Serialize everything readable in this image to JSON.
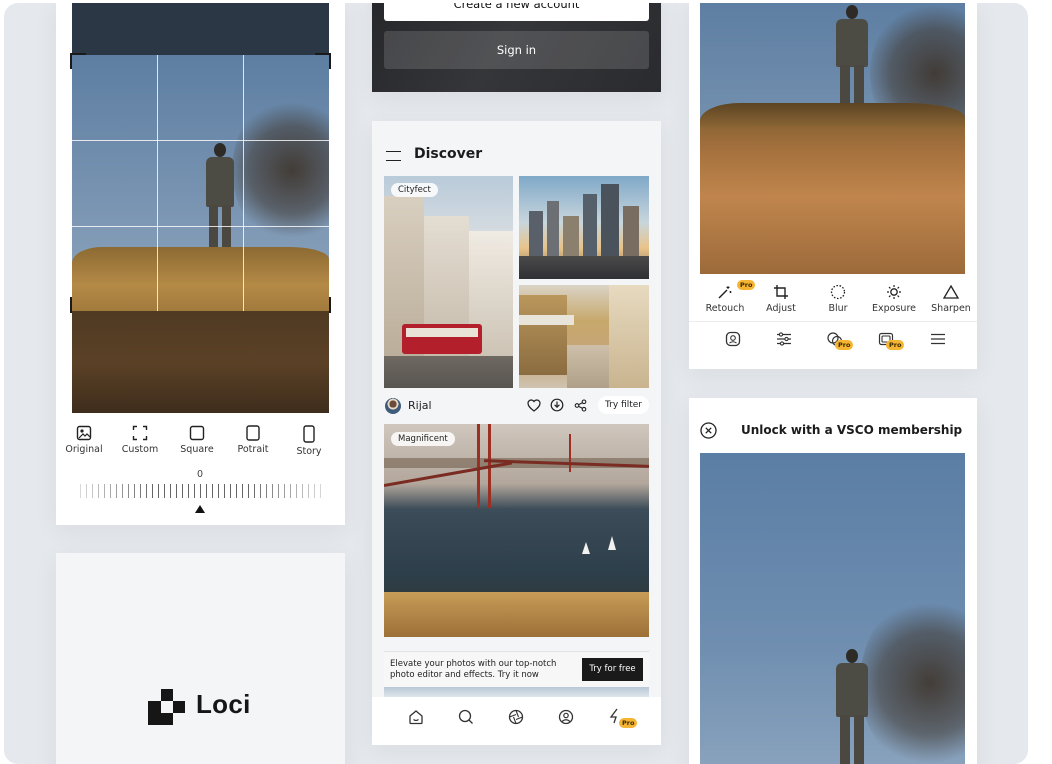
{
  "crop_screen": {
    "ratios": [
      {
        "label": "Original",
        "icon": "image-icon"
      },
      {
        "label": "Custom",
        "icon": "crop-frame-icon"
      },
      {
        "label": "Square",
        "icon": "square-icon"
      },
      {
        "label": "Potrait",
        "icon": "portrait-icon"
      },
      {
        "label": "Story",
        "icon": "story-icon"
      }
    ],
    "rotation_value": "0"
  },
  "brand": {
    "name": "Loci",
    "icon": "loci-logo-icon"
  },
  "auth_screen": {
    "create_account_label": "Create a new account",
    "sign_in_label": "Sign in"
  },
  "discover_screen": {
    "title": "Discover",
    "photos": [
      {
        "tag": "Cityfect"
      },
      {
        "tag": "Magnificent"
      }
    ],
    "author": "Rijal",
    "try_filter_label": "Try filter",
    "promo_text": "Elevate your photos with our top-notch photo editor and effects. Try it now",
    "try_free_label": "Try for free",
    "nav": [
      "home-icon",
      "search-icon",
      "aperture-icon",
      "profile-icon",
      "pro-tools-icon"
    ],
    "pro_badge": "Pro"
  },
  "editor_screen": {
    "tools": [
      {
        "label": "Retouch",
        "icon": "magic-wand-icon",
        "pro": true
      },
      {
        "label": "Adjust",
        "icon": "crop-icon",
        "pro": false
      },
      {
        "label": "Blur",
        "icon": "blur-icon",
        "pro": false
      },
      {
        "label": "Exposure",
        "icon": "sun-icon",
        "pro": false
      },
      {
        "label": "Sharpen",
        "icon": "triangle-icon",
        "pro": false
      }
    ],
    "pro_badge": "Pro"
  },
  "membership_screen": {
    "title": "Unlock with a VSCO membership"
  }
}
